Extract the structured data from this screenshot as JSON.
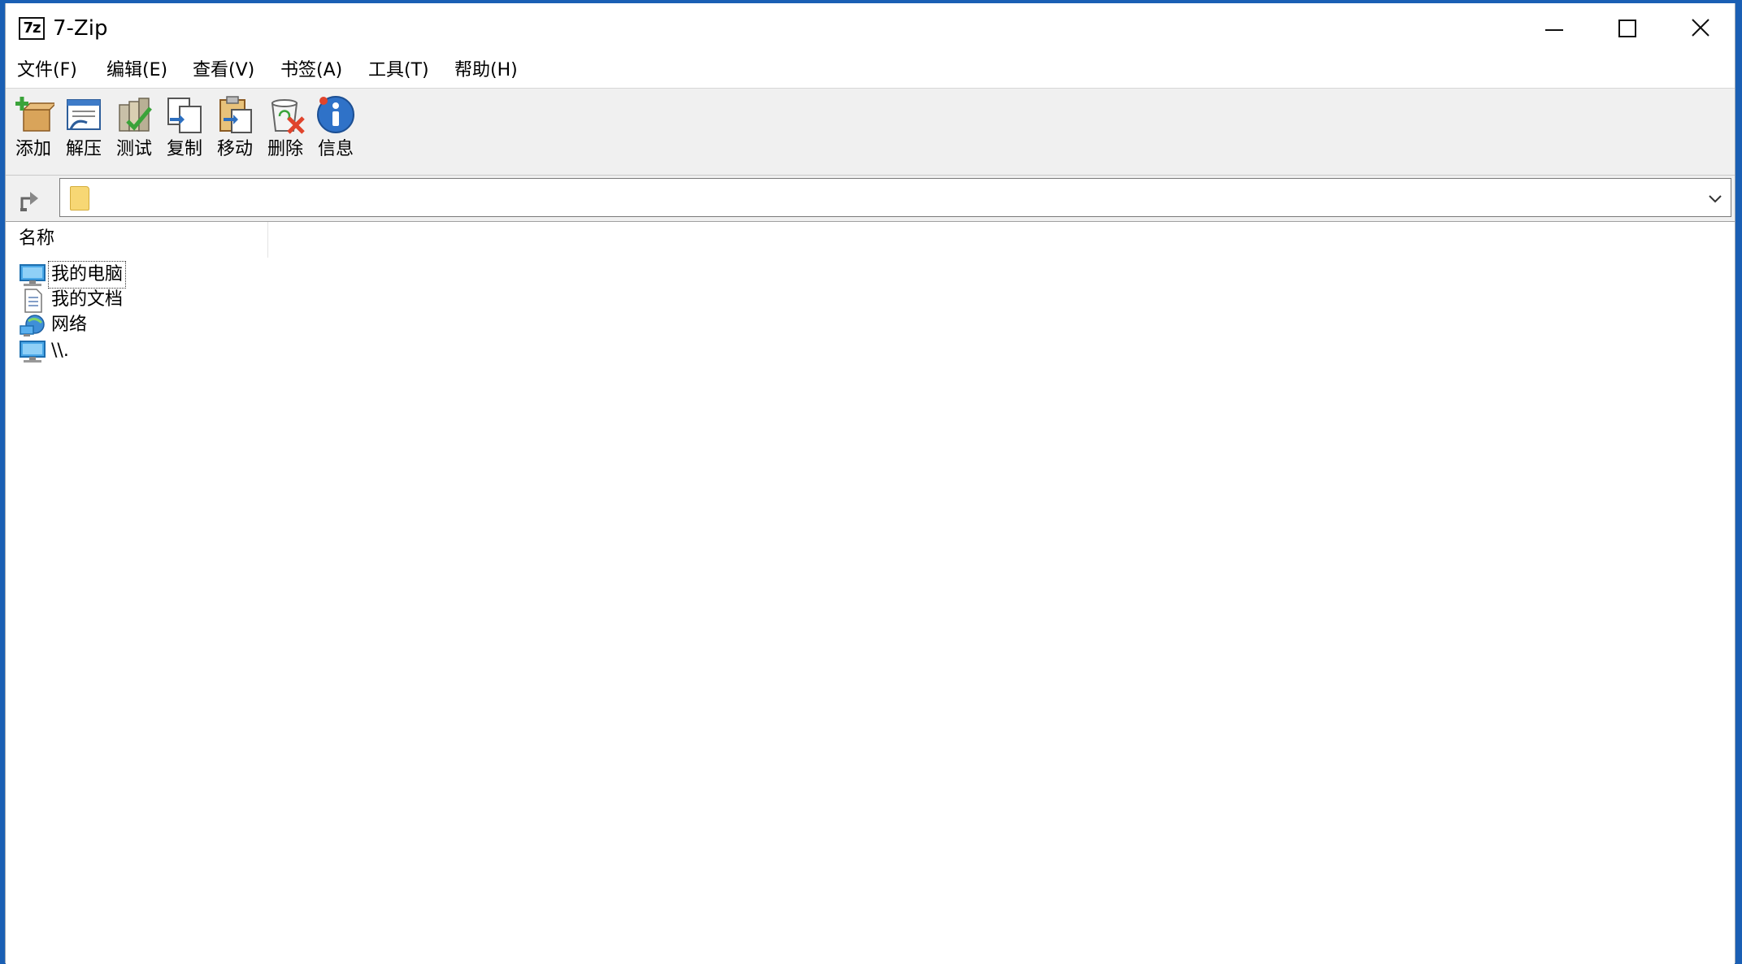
{
  "window": {
    "title": "7-Zip",
    "app_icon_text": "7z"
  },
  "menu": [
    "文件(F)",
    "编辑(E)",
    "查看(V)",
    "书签(A)",
    "工具(T)",
    "帮助(H)"
  ],
  "toolbar": {
    "add": "添加",
    "extract": "解压",
    "test": "测试",
    "copy": "复制",
    "move": "移动",
    "delete": "删除",
    "info": "信息"
  },
  "address": {
    "value": ""
  },
  "list": {
    "column_name": "名称",
    "items": [
      "我的电脑",
      "我的文档",
      "网络",
      "\\\\."
    ]
  },
  "colors": {
    "accent": "#1a5fb4",
    "toolbar_bg": "#f0f0f0"
  }
}
